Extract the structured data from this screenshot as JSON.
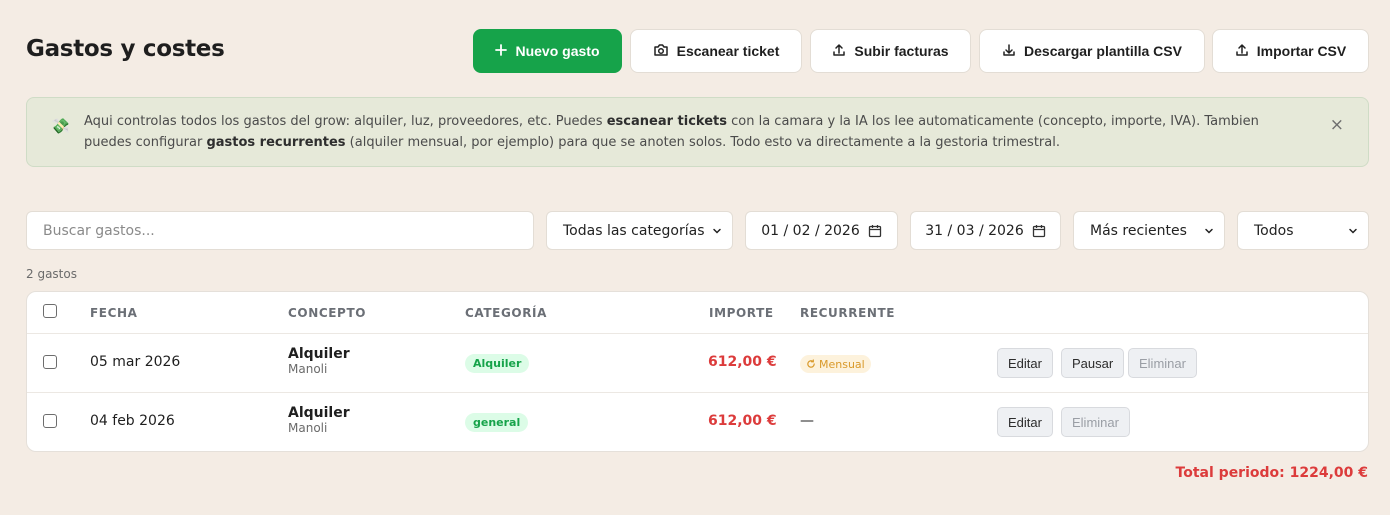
{
  "header": {
    "title": "Gastos y costes"
  },
  "toolbar": {
    "new_label": "Nuevo gasto",
    "scan_label": "Escanear ticket",
    "upload_label": "Subir facturas",
    "download_label": "Descargar plantilla CSV",
    "import_label": "Importar CSV"
  },
  "banner": {
    "icon": "💸",
    "text_1": "Aqui controlas todos los gastos del grow: alquiler, luz, proveedores, etc. Puedes ",
    "bold_1": "escanear tickets",
    "text_2": " con la camara y la IA los lee automaticamente (concepto, importe, IVA). Tambien puedes configurar ",
    "bold_2": "gastos recurrentes",
    "text_3": " (alquiler mensual, por ejemplo) para que se anoten solos. Todo esto va directamente a la gestoria trimestral.",
    "close": "×"
  },
  "filters": {
    "search_placeholder": "Buscar gastos...",
    "category": "Todas las categorías",
    "date_from": "01 / 02 / 2026",
    "date_to": "31 / 03 / 2026",
    "sort": "Más recientes",
    "status": "Todos"
  },
  "count": "2 gastos",
  "table": {
    "headers": [
      "FECHA",
      "CONCEPTO",
      "CATEGORÍA",
      "IMPORTE",
      "RECURRENTE"
    ],
    "rows": [
      {
        "date": "05 mar 2026",
        "concept": "Alquiler",
        "provider": "Manoli",
        "category": "Alquiler",
        "amount": "612,00 €",
        "recurrent": "Mensual",
        "actions": [
          "Editar",
          "Pausar",
          "Eliminar"
        ]
      },
      {
        "date": "04 feb 2026",
        "concept": "Alquiler",
        "provider": "Manoli",
        "category": "general",
        "amount": "612,00 €",
        "recurrent": "—",
        "actions": [
          "Editar",
          "Eliminar"
        ]
      }
    ]
  },
  "total": "Total periodo: 1224,00 €",
  "colors": {
    "primary": "#16a34a",
    "danger": "#dc3b3b",
    "background": "#f4ece4"
  }
}
